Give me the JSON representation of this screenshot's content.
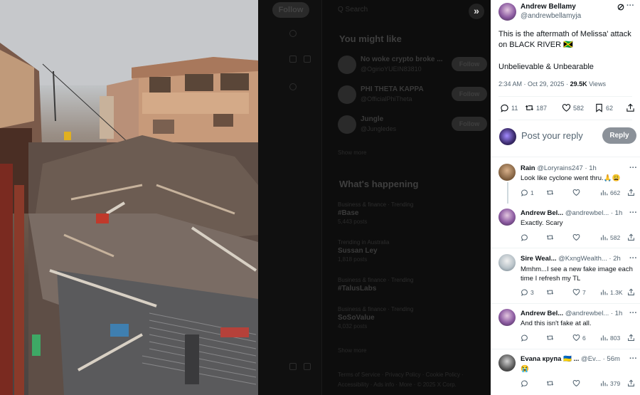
{
  "background_page": {
    "follow_top": "Follow",
    "search_hint": "Q Search",
    "might_like_title": "You might like",
    "suggestions": [
      {
        "name": "No woke crypto broke ...",
        "handle": "@OgirioYUEIN83810",
        "follow": "Follow"
      },
      {
        "name": "PHI THETA KAPPA",
        "handle": "@OfficialPhiTheta",
        "follow": "Follow"
      },
      {
        "name": "Jungle",
        "handle": "@Jungledes",
        "follow": "Follow"
      }
    ],
    "show_more": "Show more",
    "whats_happening_title": "What's happening",
    "trends": [
      {
        "category": "Business & finance · Trending",
        "title": "#Base",
        "count": "5,443 posts"
      },
      {
        "category": "Trending in Australia",
        "title": "Sussan Ley",
        "count": "1,818 posts"
      },
      {
        "category": "Business & finance · Trending",
        "title": "#TalusLabs",
        "count": ""
      },
      {
        "category": "Business & finance · Trending",
        "title": "SoSoValue",
        "count": "4,032 posts"
      }
    ],
    "show_more_2": "Show more",
    "footer": "Terms of Service · Privacy Policy · Cookie Policy · Accessibility · Ads info · More · © 2025 X Corp."
  },
  "expand_glyph": "»",
  "tweet": {
    "author_name": "Andrew Bellamy",
    "author_handle": "@andrewbellamyja",
    "text_line1": "This is the aftermath of Melissa' attack",
    "text_line2": "on BLACK RIVER 🇯🇲",
    "text_line3": "Unbelievable & Unbearable",
    "timestamp": "2:34 AM · Oct 29, 2025 · ",
    "views_count": "29.5K",
    "views_label": " Views",
    "replies": "11",
    "reposts": "187",
    "likes": "582",
    "bookmarks": "62"
  },
  "reply_box": {
    "placeholder": "Post your reply",
    "button": "Reply"
  },
  "comments": [
    {
      "name": "Rain",
      "handle": "@Loryrains247 · 1h",
      "text": "Look like cyclone went thru.🙏😩",
      "text2": "",
      "replies": "1",
      "reposts": "",
      "likes": "",
      "views": "662"
    },
    {
      "name": "Andrew Bel...",
      "handle": "@andrewbel... · 1h",
      "text": "Exactly. Scary",
      "text2": "",
      "replies": "",
      "reposts": "",
      "likes": "",
      "views": "582"
    },
    {
      "name": "Sire Weal...",
      "handle": "@KxngWealth... · 2h",
      "text": "Mmhm...I see a new fake image each",
      "text2": "time I refresh my TL",
      "replies": "3",
      "reposts": "",
      "likes": "7",
      "views": "1.3K"
    },
    {
      "name": "Andrew Bel...",
      "handle": "@andrewbel... · 1h",
      "text": "And this isn't fake at all.",
      "text2": "",
      "replies": "",
      "reposts": "",
      "likes": "6",
      "views": "803"
    },
    {
      "name": "Evana крупа 🇺🇦 ...",
      "handle": "@Ev... · 56m",
      "text": "😭",
      "text2": "",
      "replies": "",
      "reposts": "",
      "likes": "",
      "views": "379"
    }
  ]
}
